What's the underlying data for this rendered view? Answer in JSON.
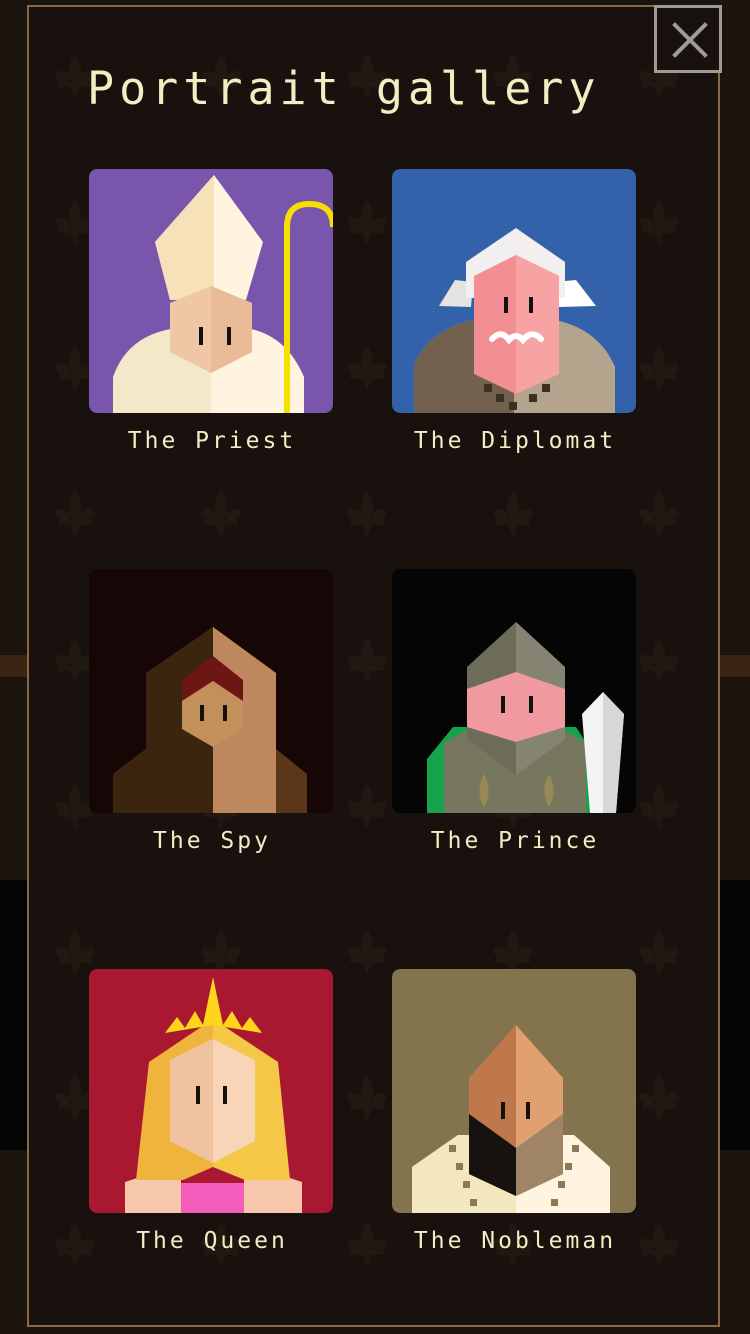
{
  "gallery": {
    "title": "Portrait gallery",
    "close_icon": "close-icon",
    "background_pattern_icon": "fleur-de-lis-icon",
    "colors": {
      "background": "#1b140f",
      "panel_border": "#8a6844",
      "text": "#f3edc2",
      "close_button": "#9f9b97"
    },
    "portraits": [
      {
        "label": "The Priest",
        "background_color": "#7a55ac"
      },
      {
        "label": "The Diplomat",
        "background_color": "#3462aa"
      },
      {
        "label": "The Spy",
        "background_color": "#160605"
      },
      {
        "label": "The Prince",
        "background_color": "#050505"
      },
      {
        "label": "The Queen",
        "background_color": "#aa1730"
      },
      {
        "label": "The Nobleman",
        "background_color": "#83744d"
      }
    ]
  }
}
